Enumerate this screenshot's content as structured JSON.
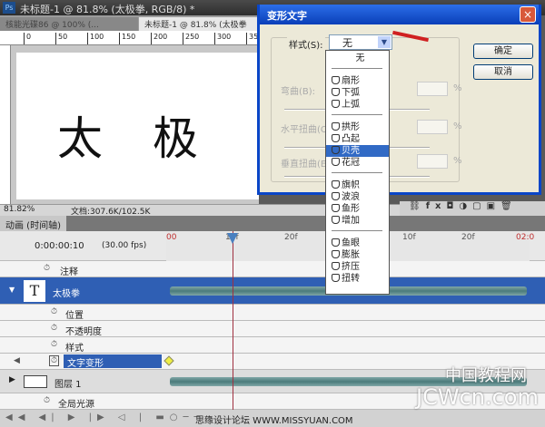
{
  "window": {
    "title": "未标题-1 @ 81.8% (太极拳, RGB/8) *",
    "logo": "Ps"
  },
  "tabs": [
    {
      "label": "核能光碟86 @ 100% (..."
    },
    {
      "label": "未标题-1 @ 81.8% (太极拳"
    }
  ],
  "ruler": [
    "0",
    "50",
    "100",
    "150",
    "200",
    "250",
    "300",
    "350"
  ],
  "canvas": {
    "chars": [
      "太",
      "极"
    ]
  },
  "status": {
    "zoom": "81.82%",
    "doc": "文档:307.6K/102.5K"
  },
  "timeline": {
    "tab": "动画 (时间轴)",
    "time": "0:00:00:10",
    "fps": "(30.00 fps)",
    "frames": [
      "00",
      "10f",
      "20f",
      "01:00",
      "10f",
      "20f",
      "02:0"
    ],
    "rows": [
      {
        "label": "注释"
      },
      {
        "label": "太极拳"
      },
      {
        "label": "位置"
      },
      {
        "label": "不透明度"
      },
      {
        "label": "样式"
      },
      {
        "label": "文字变形"
      },
      {
        "label": "图层 1"
      },
      {
        "label": "全局光源"
      }
    ]
  },
  "dialog": {
    "title": "变形文字",
    "close": "×",
    "style_label": "样式(S):",
    "style_value": "无",
    "bend": "弯曲(B):",
    "hdist": "水平扭曲(O):",
    "vdist": "垂直扭曲(E):",
    "pct": "%",
    "ok": "确定",
    "cancel": "取消"
  },
  "dropdown": {
    "items": [
      "无",
      "扇形",
      "下弧",
      "上弧",
      "拱形",
      "凸起",
      "贝壳",
      "花冠",
      "旗帜",
      "波浪",
      "鱼形",
      "增加",
      "鱼眼",
      "膨胀",
      "挤压",
      "扭转"
    ],
    "selected": "贝壳",
    "highlight_color": "#316ac5"
  },
  "watermark": {
    "site": "JCWcn.com",
    "cn": "中国教程网",
    "forum": "思缘设计论坛 WWW.MISSYUAN.COM"
  }
}
